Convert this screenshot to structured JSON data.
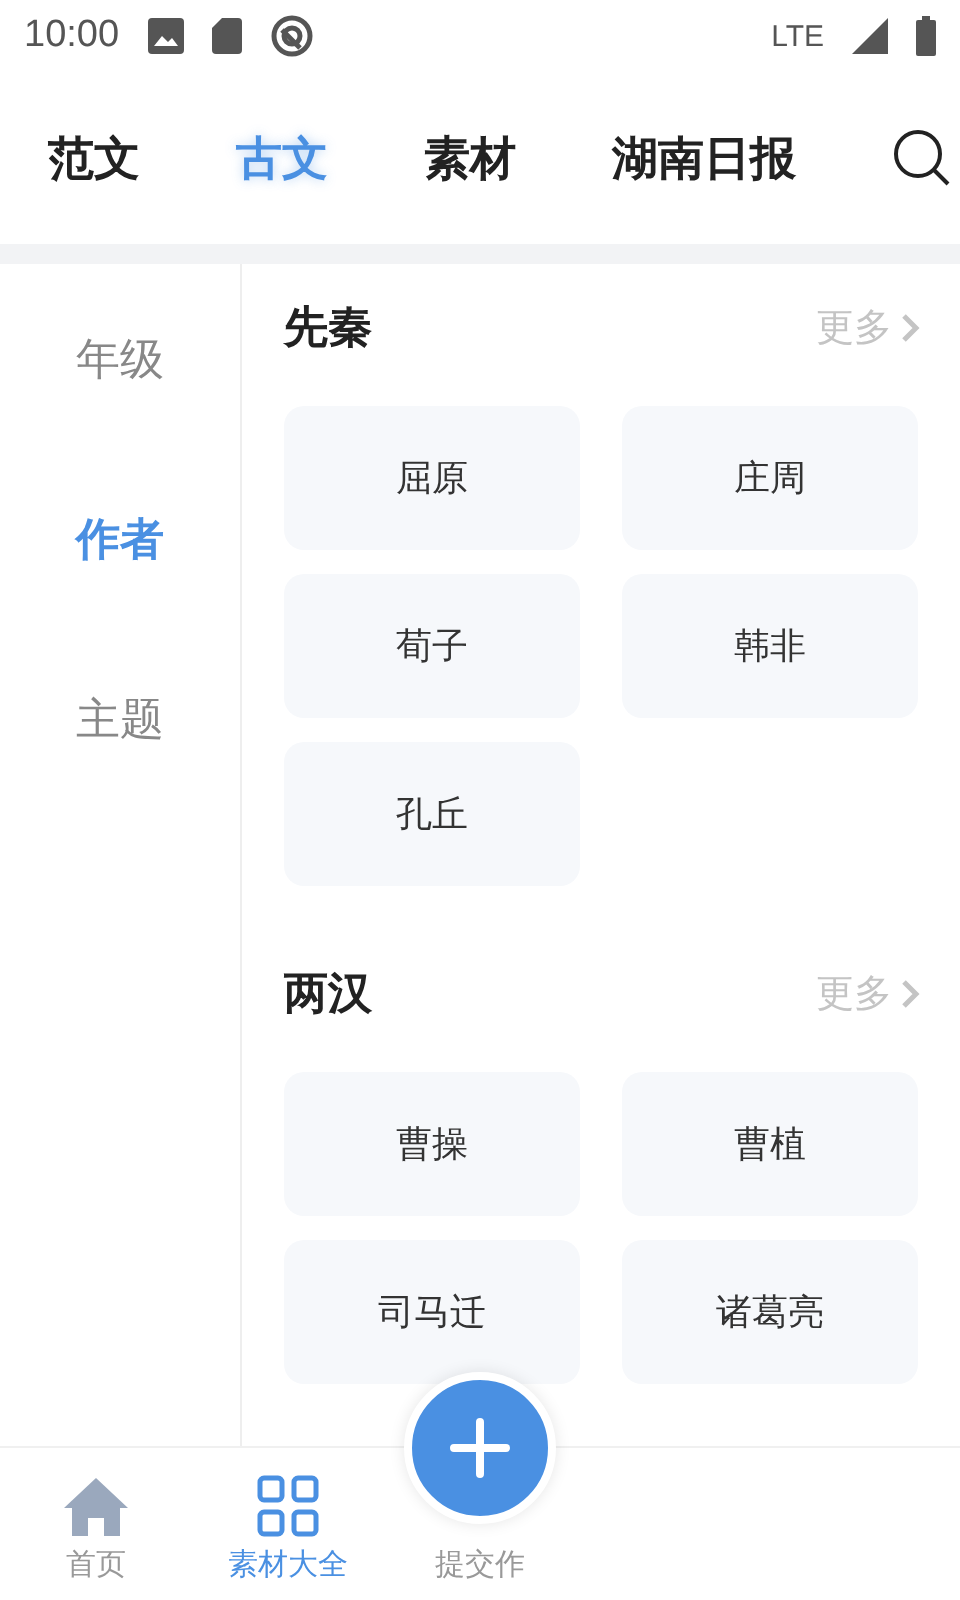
{
  "status_bar": {
    "time": "10:00",
    "network": "LTE"
  },
  "tabs": [
    {
      "label": "范文",
      "selected": false
    },
    {
      "label": "古文",
      "selected": true
    },
    {
      "label": "素材",
      "selected": false
    },
    {
      "label": "湖南日报",
      "selected": false
    }
  ],
  "sidebar": [
    {
      "label": "年级",
      "selected": false
    },
    {
      "label": "作者",
      "selected": true
    },
    {
      "label": "主题",
      "selected": false
    }
  ],
  "sections": [
    {
      "title": "先秦",
      "more": "更多",
      "items": [
        "屈原",
        "庄周",
        "荀子",
        "韩非",
        "孔丘"
      ]
    },
    {
      "title": "两汉",
      "more": "更多",
      "items": [
        "曹操",
        "曹植",
        "司马迁",
        "诸葛亮"
      ]
    }
  ],
  "bottom_nav": [
    {
      "label": "首页",
      "kind": "home",
      "selected": false
    },
    {
      "label": "素材大全",
      "kind": "grid",
      "selected": true
    },
    {
      "label": "提交作",
      "kind": "submit",
      "selected": false
    }
  ]
}
